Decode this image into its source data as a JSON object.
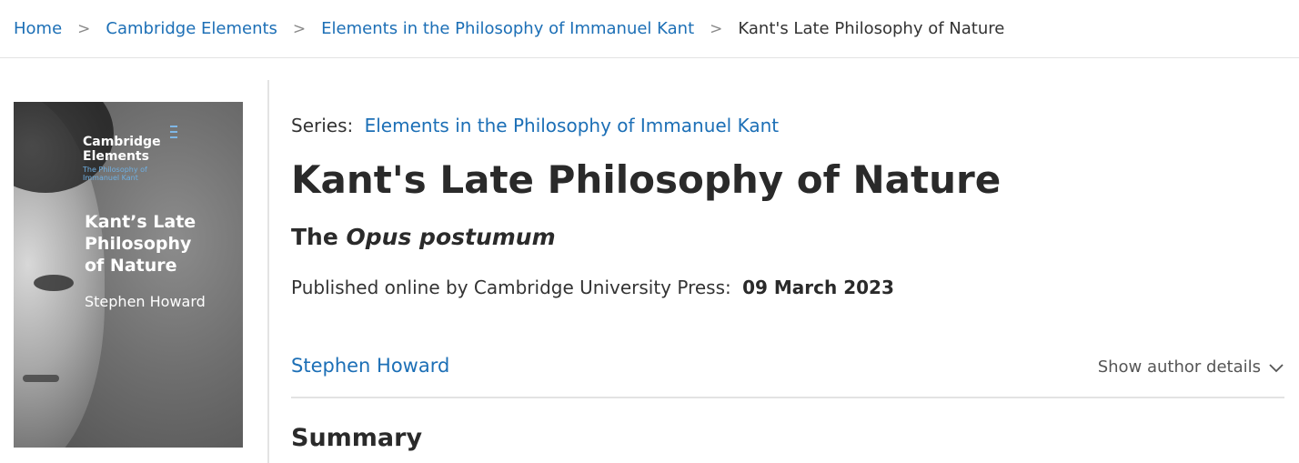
{
  "breadcrumb": {
    "items": [
      {
        "label": "Home"
      },
      {
        "label": "Cambridge Elements"
      },
      {
        "label": "Elements in the Philosophy of Immanuel Kant"
      }
    ],
    "separator": ">",
    "current": "Kant's Late Philosophy of Nature"
  },
  "cover": {
    "brand_line1": "Cambridge",
    "brand_line2": "Elements",
    "series_line1": "The Philosophy of",
    "series_line2": "Immanuel Kant",
    "title_line1": "Kant’s Late",
    "title_line2": "Philosophy",
    "title_line3": "of Nature",
    "author": "Stephen Howard"
  },
  "book": {
    "series_label": "Series:",
    "series_name": "Elements in the Philosophy of Immanuel Kant",
    "title": "Kant's Late Philosophy of Nature",
    "subtitle_prefix": "The",
    "subtitle_italic": "Opus postumum",
    "published_label": "Published online by Cambridge University Press:",
    "published_date": "09 March 2023",
    "author": "Stephen Howard",
    "author_toggle": "Show author details",
    "summary_heading": "Summary"
  },
  "colors": {
    "link": "#1c6fb6",
    "text": "#333333",
    "heading": "#2a2a2a",
    "divider": "#e3e3e3"
  }
}
